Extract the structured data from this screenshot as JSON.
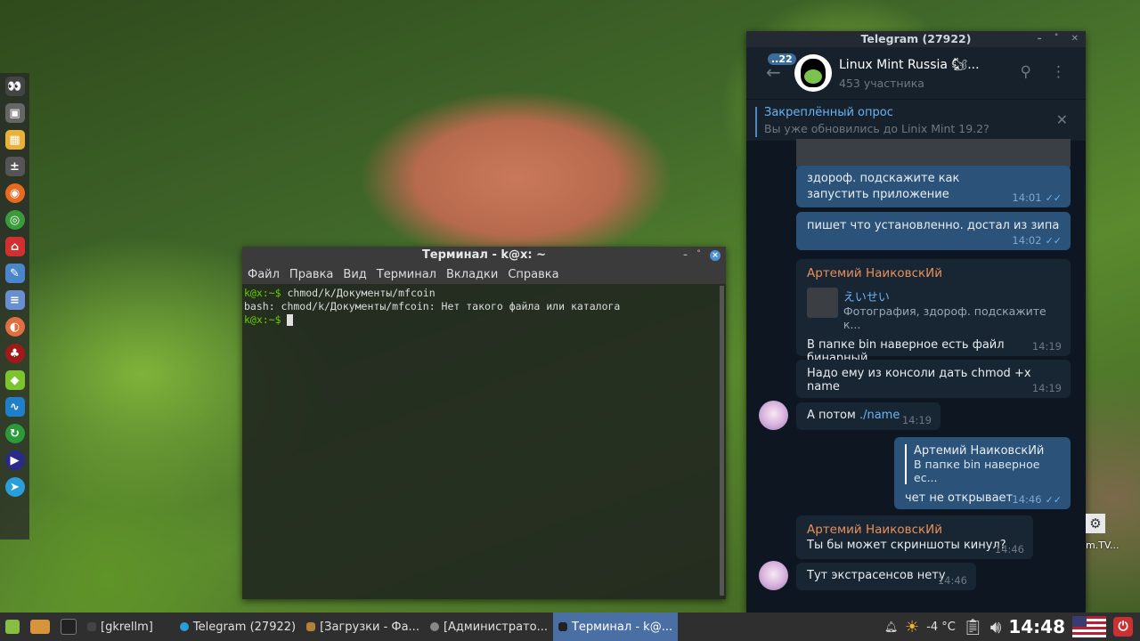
{
  "terminal": {
    "title": "Терминал - k@x: ~",
    "menu": [
      "Файл",
      "Правка",
      "Вид",
      "Терминал",
      "Вкладки",
      "Справка"
    ],
    "lines": [
      {
        "prompt": "k@x:~$",
        "text": " chmod/k/Документы/mfcoin"
      },
      {
        "prompt": "",
        "text": "bash: chmod/k/Документы/mfcoin: Нет такого файла или каталога"
      },
      {
        "prompt": "k@x:~$",
        "text": " "
      }
    ],
    "controls": {
      "minimize": "–",
      "maximize": "˚",
      "close": "×"
    }
  },
  "telegram": {
    "window_title": "Telegram (27922)",
    "unread_badge": "22",
    "chat_title": "Linux Mint Russia 🐿...",
    "chat_subtitle": "453 участника",
    "pinned": {
      "title": "Закреплённый опрос",
      "text": "Вы уже обновились до Linix Mint 19.2?"
    },
    "messages": [
      {
        "text": "здороф. подскажите как запустить приложение",
        "time": "14:01"
      },
      {
        "text": "пишет что установленно. достал из зипа",
        "time": "14:02"
      },
      {
        "sender": "Артемий НаиковскИй",
        "quote_name": "えいせい",
        "quote_text": "Фотография, здороф. подскажите к...",
        "text": "В папке bin наверное есть файл бинарный",
        "time": "14:19"
      },
      {
        "text": "Надо ему из консоли дать chmod +x name",
        "time": "14:19"
      },
      {
        "text_prefix": "А потом ",
        "text_link": "./name",
        "time": "14:19"
      },
      {
        "quote_name": "Артемий НаиковскИй",
        "quote_text": "В папке bin наверное ес...",
        "text": "чет не открывает",
        "time": "14:46"
      },
      {
        "sender": "Артемий НаиковскИй",
        "text": "Ты бы может скриншоты кинул?",
        "time": "14:46"
      },
      {
        "text": "Тут экстрасенсов нету",
        "time": "14:46"
      }
    ]
  },
  "desktop_widget": {
    "text": "m.TV..."
  },
  "taskbar": {
    "items": [
      "[gkrellm]",
      "Telegram (27922)",
      "[Загрузки - Фа...",
      "[Администрато...",
      "Терминал - k@..."
    ],
    "weather": "-4 °C",
    "clock": "14:48"
  }
}
